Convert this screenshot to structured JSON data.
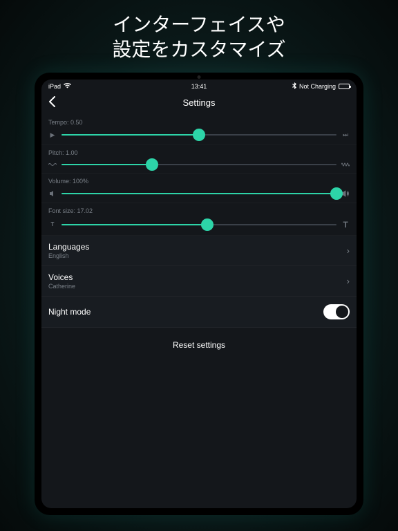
{
  "promo": {
    "line1": "インターフェイスや",
    "line2": "設定をカスタマイズ"
  },
  "statusBar": {
    "device": "iPad",
    "time": "13:41",
    "charging": "Not Charging"
  },
  "nav": {
    "title": "Settings"
  },
  "sliders": {
    "tempo": {
      "label": "Tempo: 0.50",
      "percent": 50
    },
    "pitch": {
      "label": "Pitch: 1.00",
      "percent": 33
    },
    "volume": {
      "label": "Volume: 100%",
      "percent": 100
    },
    "fontSize": {
      "label": "Font size: 17.02",
      "percent": 53
    }
  },
  "rows": {
    "languages": {
      "title": "Languages",
      "value": "English"
    },
    "voices": {
      "title": "Voices",
      "value": "Catherine"
    },
    "nightMode": {
      "title": "Night mode",
      "enabled": true
    }
  },
  "reset": {
    "label": "Reset settings"
  }
}
